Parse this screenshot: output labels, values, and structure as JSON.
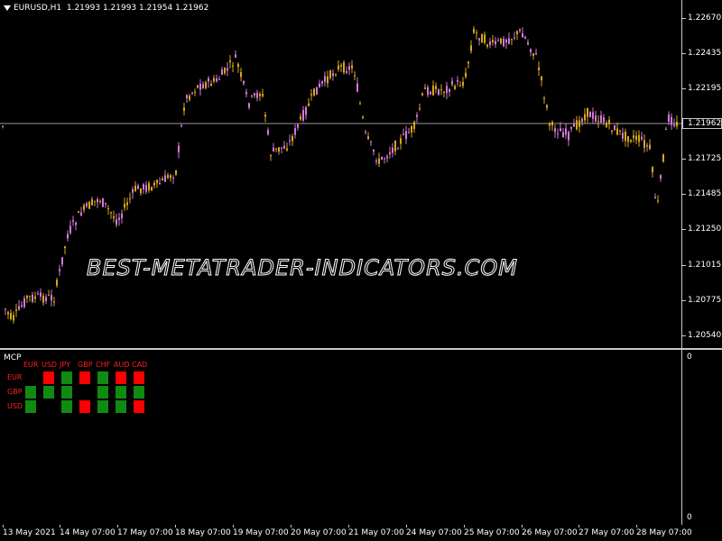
{
  "header": {
    "symbol": "EURUSD,H1",
    "ohlc": "1.21993 1.21993 1.21954 1.21962"
  },
  "watermark": "BEST-METATRADER-INDICATORS.COM",
  "price_scale": {
    "labels": [
      "1.22670",
      "1.22435",
      "1.22195",
      "1.21725",
      "1.21485",
      "1.21250",
      "1.21015",
      "1.20775",
      "1.20540"
    ],
    "current_price": "1.21962"
  },
  "indicator": {
    "title": "MCP",
    "columns": [
      "EUR",
      "USD",
      "JPY",
      "GBP",
      "CHF",
      "AUD",
      "CAD"
    ],
    "rows": [
      {
        "label": "EUR",
        "cells": [
          "",
          "red",
          "green",
          "red",
          "green",
          "red",
          "red"
        ]
      },
      {
        "label": "GBP",
        "cells": [
          "green",
          "green",
          "green",
          "",
          "green",
          "green",
          "green"
        ]
      },
      {
        "label": "USD",
        "cells": [
          "green",
          "",
          "green",
          "red",
          "green",
          "green",
          "red"
        ]
      }
    ],
    "scale_top": "0",
    "scale_bottom": "0"
  },
  "time_axis": [
    "13 May 2021",
    "14 May 07:00",
    "17 May 07:00",
    "18 May 07:00",
    "19 May 07:00",
    "20 May 07:00",
    "21 May 07:00",
    "24 May 07:00",
    "25 May 07:00",
    "26 May 07:00",
    "27 May 07:00",
    "28 May 07:00"
  ],
  "colors": {
    "bull": "#d9a61c",
    "bear": "#d27ad8",
    "cell_red": "#ff0000",
    "cell_green": "#118a11",
    "axis_label_red": "#ff2020"
  }
}
